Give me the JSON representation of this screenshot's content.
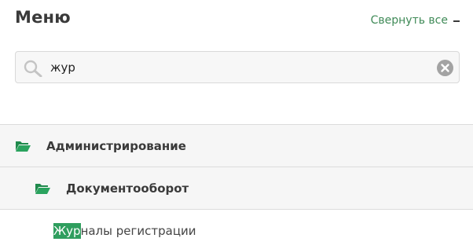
{
  "header": {
    "title": "Меню",
    "collapse_all_label": "Свернуть все"
  },
  "search": {
    "value": "жур",
    "placeholder": ""
  },
  "tree": {
    "level0_label": "Администрирование",
    "level1_label": "Документооборот",
    "leaf": {
      "highlight": "Жур",
      "rest": "налы регистрации"
    }
  },
  "colors": {
    "accent_green": "#2f9e5e",
    "link_green": "#3f8a57",
    "row_background": "#f6f6f6"
  },
  "icons": {
    "search": "search-icon",
    "clear": "clear-icon",
    "folder_open": "folder-open-icon",
    "collapse": "minus-icon"
  }
}
